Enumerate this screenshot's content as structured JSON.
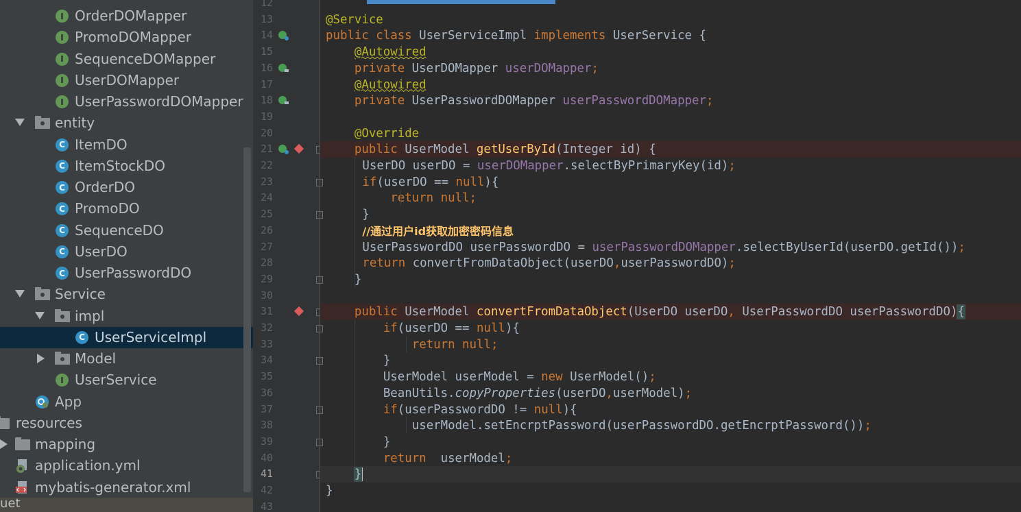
{
  "project_tree": {
    "items": [
      {
        "label": "OrderDOMapper",
        "icon": "interface-icon",
        "kind": "interface",
        "indent": 2
      },
      {
        "label": "PromoDOMapper",
        "icon": "interface-icon",
        "kind": "interface",
        "indent": 2
      },
      {
        "label": "SequenceDOMapper",
        "icon": "interface-icon",
        "kind": "interface",
        "indent": 2
      },
      {
        "label": "UserDOMapper",
        "icon": "interface-icon",
        "kind": "interface",
        "indent": 2
      },
      {
        "label": "UserPasswordDOMapper",
        "icon": "interface-icon",
        "kind": "interface",
        "indent": 2
      },
      {
        "label": "entity",
        "icon": "package-icon",
        "kind": "package",
        "expanded": true,
        "indent": 1
      },
      {
        "label": "ItemDO",
        "icon": "class-icon",
        "kind": "class",
        "indent": 2
      },
      {
        "label": "ItemStockDO",
        "icon": "class-icon",
        "kind": "class",
        "indent": 2
      },
      {
        "label": "OrderDO",
        "icon": "class-icon",
        "kind": "class",
        "indent": 2
      },
      {
        "label": "PromoDO",
        "icon": "class-icon",
        "kind": "class",
        "indent": 2
      },
      {
        "label": "SequenceDO",
        "icon": "class-icon",
        "kind": "class",
        "indent": 2
      },
      {
        "label": "UserDO",
        "icon": "class-icon",
        "kind": "class",
        "indent": 2
      },
      {
        "label": "UserPasswordDO",
        "icon": "class-icon",
        "kind": "class",
        "indent": 2
      },
      {
        "label": "Service",
        "icon": "package-icon",
        "kind": "package",
        "expanded": true,
        "indent": 1
      },
      {
        "label": "impl",
        "icon": "package-icon",
        "kind": "package",
        "expanded": true,
        "indent": 2
      },
      {
        "label": "UserServiceImpl",
        "icon": "class-icon",
        "kind": "class",
        "indent": 3,
        "selected": true
      },
      {
        "label": "Model",
        "icon": "package-icon",
        "kind": "package",
        "expanded": false,
        "indent": 2
      },
      {
        "label": "UserService",
        "icon": "interface-icon",
        "kind": "interface",
        "indent": 2
      },
      {
        "label": "App",
        "icon": "spring-boot-app-icon",
        "kind": "app",
        "indent": 1
      },
      {
        "label": "resources",
        "icon": "resources-folder-icon",
        "kind": "folder",
        "indent": 0
      },
      {
        "label": "mapping",
        "icon": "folder-icon",
        "kind": "folder",
        "expanded": false,
        "indent": 0
      },
      {
        "label": "application.yml",
        "icon": "yaml-file-icon",
        "kind": "file",
        "indent": 0
      },
      {
        "label": "mybatis-generator.xml",
        "icon": "xml-file-icon",
        "kind": "file",
        "indent": 0
      }
    ],
    "bottom_tab_label": "uet"
  },
  "editor": {
    "current_line": 41,
    "first_line_number": 12
  }
}
